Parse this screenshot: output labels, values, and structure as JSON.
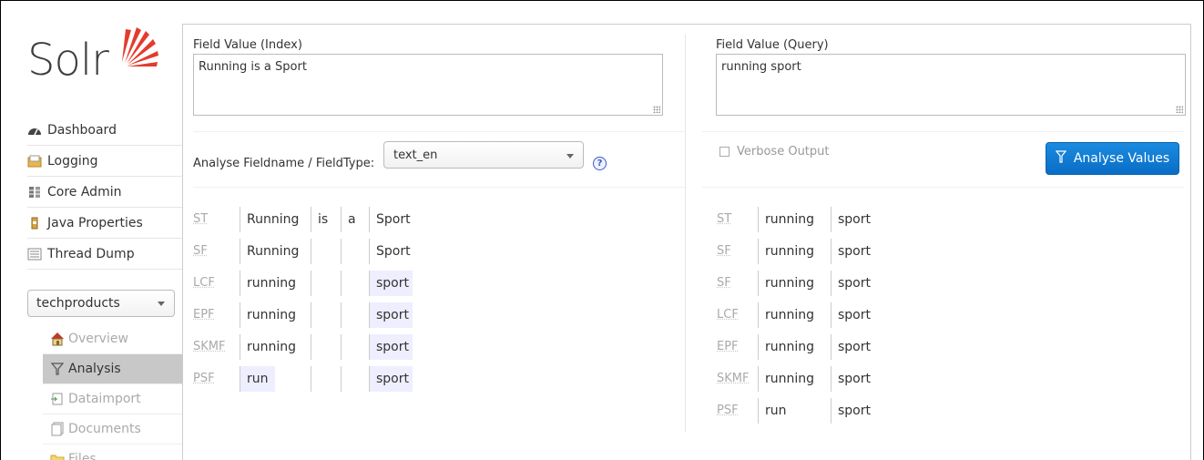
{
  "logo": {
    "text": "Solr"
  },
  "nav": {
    "items": [
      {
        "label": "Dashboard",
        "icon": "dashboard-icon"
      },
      {
        "label": "Logging",
        "icon": "logging-icon"
      },
      {
        "label": "Core Admin",
        "icon": "core-admin-icon"
      },
      {
        "label": "Java Properties",
        "icon": "java-properties-icon"
      },
      {
        "label": "Thread Dump",
        "icon": "thread-dump-icon"
      }
    ]
  },
  "core_selector": {
    "value": "techproducts"
  },
  "core_nav": {
    "items": [
      {
        "label": "Overview",
        "icon": "home-icon"
      },
      {
        "label": "Analysis",
        "icon": "filter-icon",
        "active": true
      },
      {
        "label": "Dataimport",
        "icon": "dataimport-icon"
      },
      {
        "label": "Documents",
        "icon": "documents-icon"
      },
      {
        "label": "Files",
        "icon": "folder-icon"
      }
    ]
  },
  "index": {
    "label": "Field Value (Index)",
    "value": "Running is a Sport"
  },
  "query": {
    "label": "Field Value (Query)",
    "value": "running sport"
  },
  "fieldtype": {
    "label": "Analyse Fieldname / FieldType:",
    "value": "text_en",
    "help": "?"
  },
  "verbose": {
    "label": "Verbose Output",
    "checked": false
  },
  "analyse_button": {
    "label": "Analyse Values"
  },
  "colors": {
    "accent": "#0a6dc5",
    "token_highlight": "#eeeeff",
    "active_nav": "#c8c8c8"
  },
  "index_analysis": [
    {
      "stage": "ST",
      "tokens": [
        "Running",
        "is",
        "a",
        "Sport"
      ]
    },
    {
      "stage": "SF",
      "tokens": [
        "Running",
        "",
        "",
        "Sport"
      ]
    },
    {
      "stage": "LCF",
      "tokens": [
        "running",
        "",
        "",
        "sport"
      ]
    },
    {
      "stage": "EPF",
      "tokens": [
        "running",
        "",
        "",
        "sport"
      ]
    },
    {
      "stage": "SKMF",
      "tokens": [
        "running",
        "",
        "",
        "sport"
      ]
    },
    {
      "stage": "PSF",
      "tokens": [
        "run",
        "",
        "",
        "sport"
      ]
    }
  ],
  "query_analysis": [
    {
      "stage": "ST",
      "tokens": [
        "running",
        "sport"
      ]
    },
    {
      "stage": "SF",
      "tokens": [
        "running",
        "sport"
      ]
    },
    {
      "stage": "SF",
      "tokens": [
        "running",
        "sport"
      ]
    },
    {
      "stage": "LCF",
      "tokens": [
        "running",
        "sport"
      ]
    },
    {
      "stage": "EPF",
      "tokens": [
        "running",
        "sport"
      ]
    },
    {
      "stage": "SKMF",
      "tokens": [
        "running",
        "sport"
      ]
    },
    {
      "stage": "PSF",
      "tokens": [
        "run",
        "sport"
      ]
    }
  ]
}
